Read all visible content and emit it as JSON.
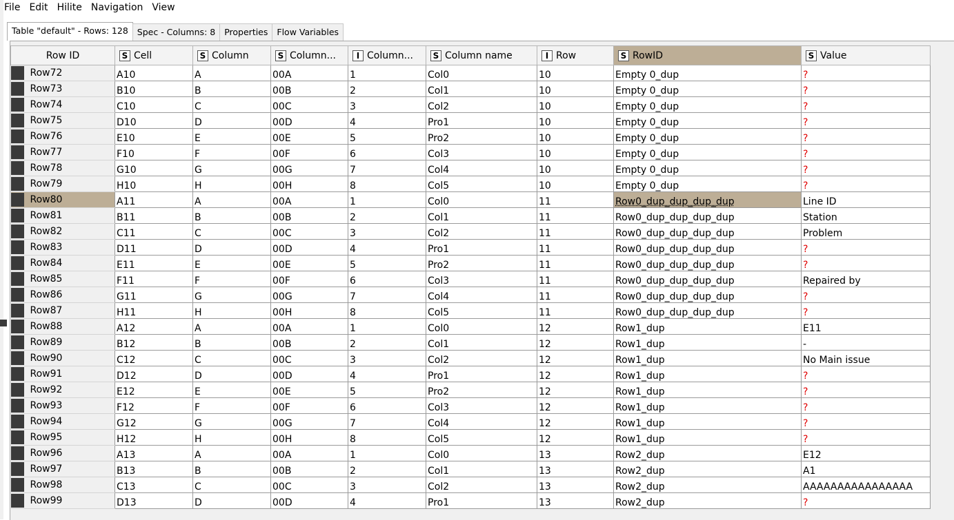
{
  "menu": [
    "File",
    "Edit",
    "Hilite",
    "Navigation",
    "View"
  ],
  "tabs": [
    {
      "label": "Table \"default\" - Rows: 128",
      "active": true
    },
    {
      "label": "Spec - Columns: 8",
      "active": false
    },
    {
      "label": "Properties",
      "active": false
    },
    {
      "label": "Flow Variables",
      "active": false
    }
  ],
  "table": {
    "rowid_header": "Row ID",
    "columns": [
      {
        "type": "S",
        "label": "Cell"
      },
      {
        "type": "S",
        "label": "Column"
      },
      {
        "type": "S",
        "label": "Column..."
      },
      {
        "type": "I",
        "label": "Column..."
      },
      {
        "type": "S",
        "label": "Column name"
      },
      {
        "type": "I",
        "label": "Row"
      },
      {
        "type": "S",
        "label": "RowID"
      },
      {
        "type": "S",
        "label": "Value"
      }
    ],
    "selected_row": "Row80",
    "selected_column_index": 6,
    "rows": [
      [
        "Row72",
        "A10",
        "A",
        "00A",
        "1",
        "Col0",
        "10",
        "Empty 0_dup",
        "?"
      ],
      [
        "Row73",
        "B10",
        "B",
        "00B",
        "2",
        "Col1",
        "10",
        "Empty 0_dup",
        "?"
      ],
      [
        "Row74",
        "C10",
        "C",
        "00C",
        "3",
        "Col2",
        "10",
        "Empty 0_dup",
        "?"
      ],
      [
        "Row75",
        "D10",
        "D",
        "00D",
        "4",
        "Pro1",
        "10",
        "Empty 0_dup",
        "?"
      ],
      [
        "Row76",
        "E10",
        "E",
        "00E",
        "5",
        "Pro2",
        "10",
        "Empty 0_dup",
        "?"
      ],
      [
        "Row77",
        "F10",
        "F",
        "00F",
        "6",
        "Col3",
        "10",
        "Empty 0_dup",
        "?"
      ],
      [
        "Row78",
        "G10",
        "G",
        "00G",
        "7",
        "Col4",
        "10",
        "Empty 0_dup",
        "?"
      ],
      [
        "Row79",
        "H10",
        "H",
        "00H",
        "8",
        "Col5",
        "10",
        "Empty 0_dup",
        "?"
      ],
      [
        "Row80",
        "A11",
        "A",
        "00A",
        "1",
        "Col0",
        "11",
        "Row0_dup_dup_dup_dup",
        "Line ID"
      ],
      [
        "Row81",
        "B11",
        "B",
        "00B",
        "2",
        "Col1",
        "11",
        "Row0_dup_dup_dup_dup",
        "Station"
      ],
      [
        "Row82",
        "C11",
        "C",
        "00C",
        "3",
        "Col2",
        "11",
        "Row0_dup_dup_dup_dup",
        "Problem"
      ],
      [
        "Row83",
        "D11",
        "D",
        "00D",
        "4",
        "Pro1",
        "11",
        "Row0_dup_dup_dup_dup",
        "?"
      ],
      [
        "Row84",
        "E11",
        "E",
        "00E",
        "5",
        "Pro2",
        "11",
        "Row0_dup_dup_dup_dup",
        "?"
      ],
      [
        "Row85",
        "F11",
        "F",
        "00F",
        "6",
        "Col3",
        "11",
        "Row0_dup_dup_dup_dup",
        "Repaired by"
      ],
      [
        "Row86",
        "G11",
        "G",
        "00G",
        "7",
        "Col4",
        "11",
        "Row0_dup_dup_dup_dup",
        "?"
      ],
      [
        "Row87",
        "H11",
        "H",
        "00H",
        "8",
        "Col5",
        "11",
        "Row0_dup_dup_dup_dup",
        "?"
      ],
      [
        "Row88",
        "A12",
        "A",
        "00A",
        "1",
        "Col0",
        "12",
        "Row1_dup",
        "E11"
      ],
      [
        "Row89",
        "B12",
        "B",
        "00B",
        "2",
        "Col1",
        "12",
        "Row1_dup",
        "-"
      ],
      [
        "Row90",
        "C12",
        "C",
        "00C",
        "3",
        "Col2",
        "12",
        "Row1_dup",
        "No Main issue"
      ],
      [
        "Row91",
        "D12",
        "D",
        "00D",
        "4",
        "Pro1",
        "12",
        "Row1_dup",
        "?"
      ],
      [
        "Row92",
        "E12",
        "E",
        "00E",
        "5",
        "Pro2",
        "12",
        "Row1_dup",
        "?"
      ],
      [
        "Row93",
        "F12",
        "F",
        "00F",
        "6",
        "Col3",
        "12",
        "Row1_dup",
        "?"
      ],
      [
        "Row94",
        "G12",
        "G",
        "00G",
        "7",
        "Col4",
        "12",
        "Row1_dup",
        "?"
      ],
      [
        "Row95",
        "H12",
        "H",
        "00H",
        "8",
        "Col5",
        "12",
        "Row1_dup",
        "?"
      ],
      [
        "Row96",
        "A13",
        "A",
        "00A",
        "1",
        "Col0",
        "13",
        "Row2_dup",
        "E12"
      ],
      [
        "Row97",
        "B13",
        "B",
        "00B",
        "2",
        "Col1",
        "13",
        "Row2_dup",
        "A1"
      ],
      [
        "Row98",
        "C13",
        "C",
        "00C",
        "3",
        "Col2",
        "13",
        "Row2_dup",
        "AAAAAAAAAAAAAAAA"
      ],
      [
        "Row99",
        "D13",
        "D",
        "00D",
        "4",
        "Pro1",
        "13",
        "Row2_dup",
        "?"
      ]
    ]
  },
  "colors": {
    "selection": "#bdae96",
    "row_marker": "#3a3a3a",
    "missing_value": "#e00000"
  }
}
